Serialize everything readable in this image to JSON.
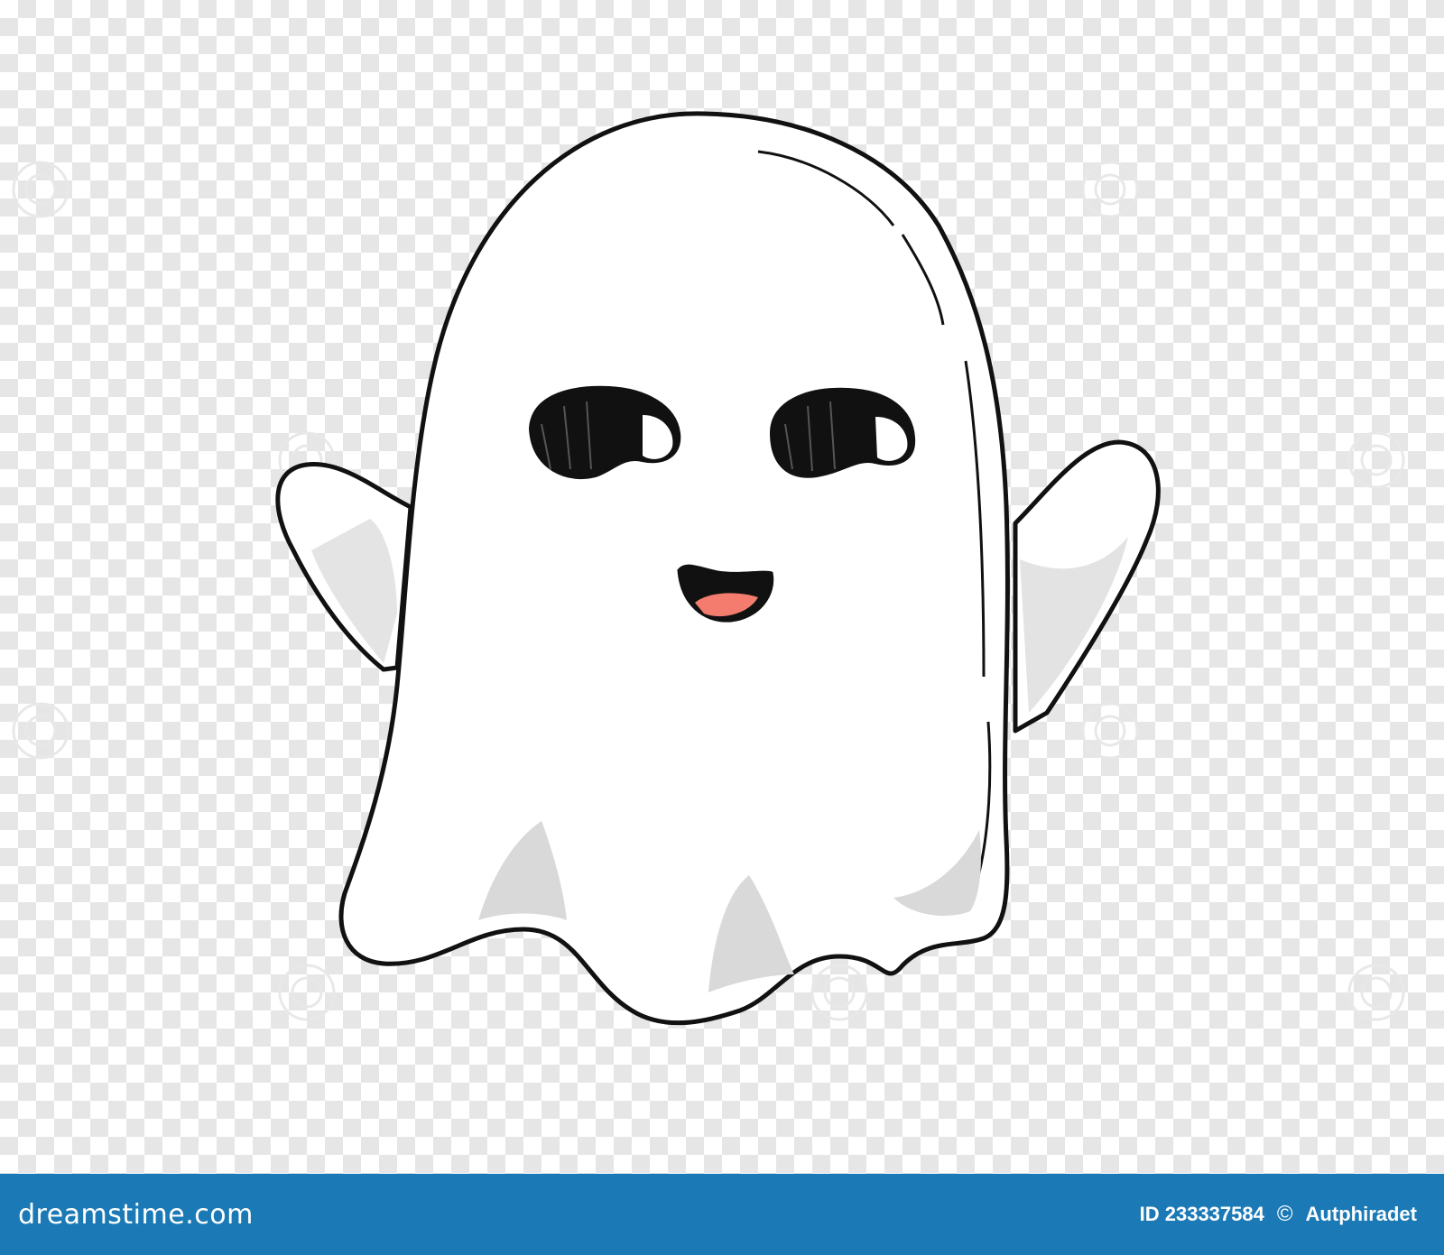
{
  "footer": {
    "brand": "dreamstime.com",
    "image_id": "ID 233337584",
    "copyright_symbol": "©",
    "author": "Autphiradet"
  },
  "colors": {
    "footer_bar": "#1b7ab6",
    "checker_light": "#ffffff",
    "checker_dark": "#e6e6e6",
    "ghost_body": "#ffffff",
    "ghost_shadow": "#d9d9d9",
    "outline": "#111111",
    "tongue": "#f47c6e"
  },
  "icons": [
    "ghost-illustration",
    "watermark-swirl-icon"
  ]
}
